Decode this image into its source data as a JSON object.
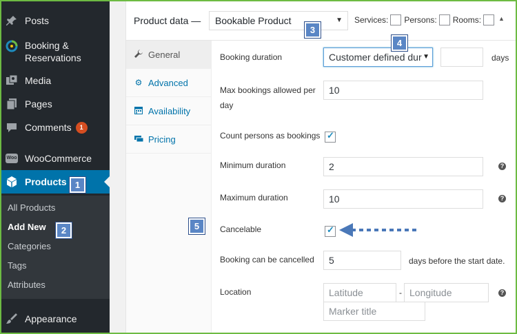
{
  "sidebar": {
    "items": [
      {
        "label": "Posts",
        "icon": "pin-icon"
      },
      {
        "label": "Booking &\nReservations",
        "icon": "booking-icon"
      },
      {
        "label": "Media",
        "icon": "media-icon"
      },
      {
        "label": "Pages",
        "icon": "pages-icon"
      },
      {
        "label": "Comments",
        "icon": "comments-icon",
        "badge": "1"
      },
      {
        "label": "WooCommerce",
        "icon": "woocommerce-icon"
      },
      {
        "label": "Products",
        "icon": "cube-icon"
      },
      {
        "label": "Appearance",
        "icon": "brush-icon"
      }
    ],
    "submenu": [
      "All Products",
      "Add New",
      "Categories",
      "Tags",
      "Attributes"
    ],
    "woo_icon_text": "Woo"
  },
  "panel": {
    "title": "Product data —",
    "product_type": "Bookable Product",
    "options": {
      "services": "Services:",
      "persons": "Persons:",
      "rooms": "Rooms:"
    },
    "tabs": [
      "General",
      "Advanced",
      "Availability",
      "Pricing"
    ],
    "fields": {
      "booking_duration_label": "Booking duration",
      "booking_duration_value": "Customer defined dur",
      "booking_duration_unit": "days",
      "max_bookings_label": "Max bookings allowed per day",
      "max_bookings_value": "10",
      "count_persons_label": "Count persons as bookings",
      "min_duration_label": "Minimum duration",
      "min_duration_value": "2",
      "max_duration_label": "Maximum duration",
      "max_duration_value": "10",
      "cancelable_label": "Cancelable",
      "cancel_label": "Booking can be cancelled",
      "cancel_value": "5",
      "cancel_suffix": "days before the start date.",
      "location_label": "Location",
      "latitude_placeholder": "Latitude",
      "location_separator": "-",
      "longitude_placeholder": "Longitude",
      "marker_placeholder": "Marker title"
    },
    "help_glyph": "?"
  },
  "callouts": [
    "1",
    "2",
    "3",
    "4",
    "5"
  ],
  "colors": {
    "accent": "#0073aa",
    "sidebar": "#23282d",
    "callout": "#5a86c5",
    "frame": "#6dbb43",
    "badge": "#d54e21"
  }
}
